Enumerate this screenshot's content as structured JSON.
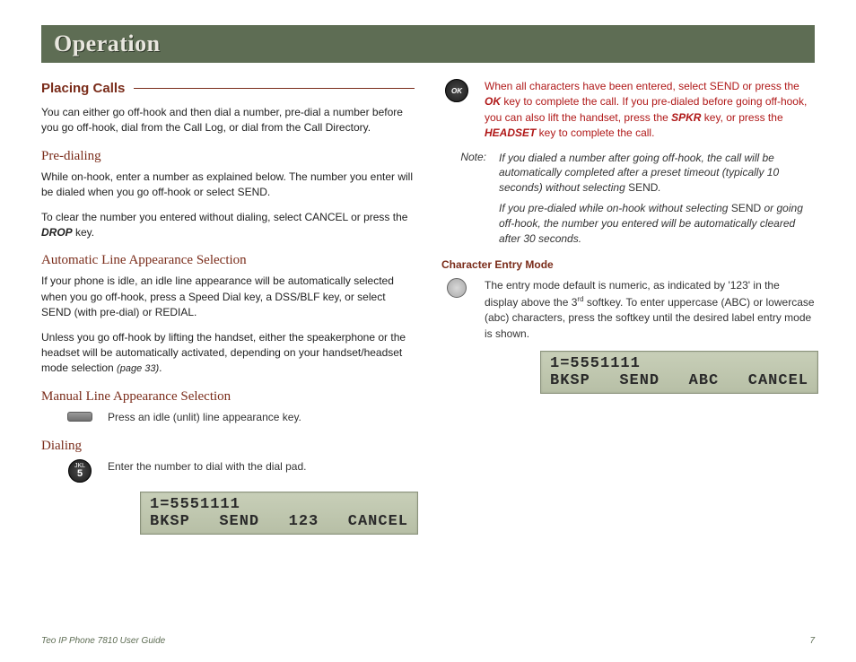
{
  "banner": {
    "title": "Operation"
  },
  "left": {
    "section_title": "Placing Calls",
    "intro": "You can either go off-hook and then dial a number, pre-dial a number before you go off-hook, dial from the Call Log, or dial from the Call Directory.",
    "predial_head": "Pre-dialing",
    "predial_p1": "While on-hook, enter a number as explained below. The number you enter will be dialed when you go off-hook or select SEND.",
    "predial_p2a": "To clear the number you entered without dialing, select CANCEL or press the ",
    "predial_drop": "DROP",
    "predial_p2b": " key.",
    "auto_head": "Automatic Line Appearance Selection",
    "auto_p1": "If your phone is idle, an idle line appearance will be automatically selected when you go off-hook, press a Speed Dial key, a DSS/BLF key, or select SEND (with pre-dial) or REDIAL.",
    "auto_p2a": "Unless you go off-hook by lifting the handset, either the speakerphone or the headset will be automatically activated, depending on your handset/headset mode selection ",
    "auto_p2_ref": "(page 33)",
    "auto_p2b": ".",
    "manual_head": "Manual Line Appearance Selection",
    "manual_text": "Press an idle (unlit) line appearance key.",
    "dialing_head": "Dialing",
    "dialing_text": "Enter the number to dial with the dial pad.",
    "dialkey": {
      "letters": "JKL",
      "num": "5"
    },
    "lcd1": {
      "line1": "1=5551111",
      "k1": "BKSP",
      "k2": "SEND",
      "k3": "123",
      "k4": "CANCEL"
    }
  },
  "right": {
    "ok_label": "OK",
    "red_a": "When all characters have been entered, select SEND or press the ",
    "red_ok": "OK",
    "red_b": " key to complete the call. If you pre-dialed before going off-hook, you can also lift the handset, press the ",
    "red_spkr": "SPKR",
    "red_c": " key, or press the ",
    "red_headset": "HEADSET",
    "red_d": " key to complete the call.",
    "note_label": "Note:",
    "note1a": "If you dialed a number after going off-hook, the call will be automatically completed after a preset timeout (typically 10 seconds) without selecting ",
    "note1_send": "SEND",
    "note1b": ".",
    "note2a": "If you pre-dialed while on-hook without selecting ",
    "note2_send": "SEND",
    "note2b": " or going off-hook, the number you entered will be automatically cleared after 30 seconds.",
    "char_head": "Character Entry Mode",
    "char_p_a": "The entry mode default is numeric, as indicated by '123' in the display above the 3",
    "char_p_sup": "rd",
    "char_p_b": " softkey. To enter uppercase (ABC) or lowercase (abc) characters, press the softkey until the desired label entry mode is shown.",
    "lcd2": {
      "line1": "1=5551111",
      "k1": "BKSP",
      "k2": "SEND",
      "k3": "ABC",
      "k4": "CANCEL"
    }
  },
  "footer": {
    "left": "Teo IP Phone 7810 User Guide",
    "right": "7"
  }
}
